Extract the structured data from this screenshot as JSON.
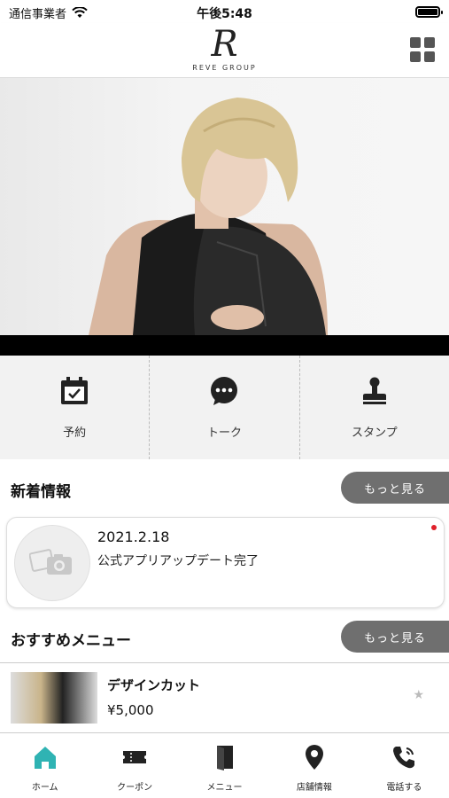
{
  "status_bar": {
    "carrier": "通信事業者",
    "time": "午後5:48"
  },
  "header": {
    "logo_mark": "R",
    "logo_text": "REVE GROUP",
    "menu_icon": "grid-icon"
  },
  "hero": {
    "image": "model-photo"
  },
  "quick_actions": [
    {
      "label": "予約",
      "icon": "calendar-check-icon"
    },
    {
      "label": "トーク",
      "icon": "chat-bubble-icon"
    },
    {
      "label": "スタンプ",
      "icon": "stamp-icon"
    }
  ],
  "news": {
    "title": "新着情報",
    "more_label": "もっと見る",
    "items": [
      {
        "date": "2021.2.18",
        "text": "公式アプリアップデート完了",
        "unread": true
      }
    ]
  },
  "recommended": {
    "title": "おすすめメニュー",
    "more_label": "もっと見る",
    "items": [
      {
        "name": "デザインカット",
        "price": "¥5,000"
      }
    ]
  },
  "tabbar": {
    "items": [
      {
        "label": "ホーム",
        "icon": "home-icon",
        "active": true
      },
      {
        "label": "クーポン",
        "icon": "ticket-icon"
      },
      {
        "label": "メニュー",
        "icon": "book-icon"
      },
      {
        "label": "店舗情報",
        "icon": "location-pin-icon"
      },
      {
        "label": "電話する",
        "icon": "phone-icon"
      }
    ]
  },
  "colors": {
    "accent": "#2fb3b3",
    "more_button": "#6f6f6f",
    "unread_dot": "#e0202a"
  }
}
